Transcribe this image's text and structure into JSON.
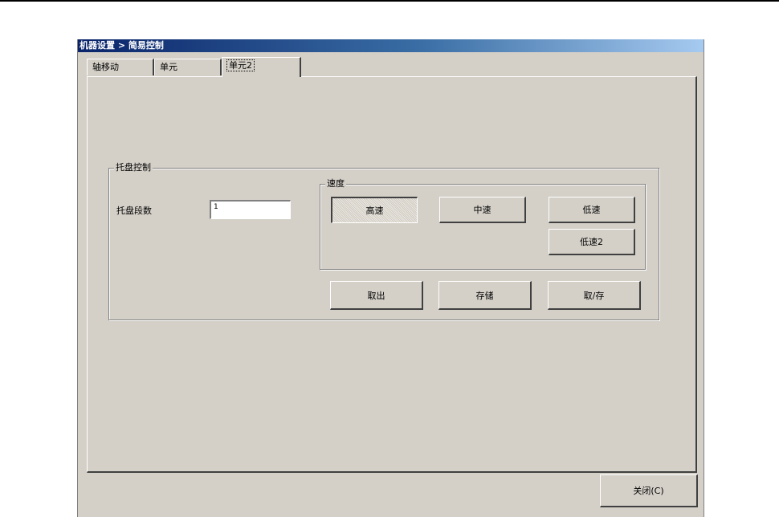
{
  "window": {
    "title": "机器设置 > 简易控制"
  },
  "tabs": [
    {
      "label": "轴移动"
    },
    {
      "label": "单元"
    },
    {
      "label": "单元2"
    }
  ],
  "tray_group": {
    "title": "托盘控制",
    "count_label": "托盘段数",
    "count_value": "1"
  },
  "speed_group": {
    "title": "速度",
    "high": "高速",
    "mid": "中速",
    "low": "低速",
    "low2": "低速2"
  },
  "actions": {
    "take_out": "取出",
    "store": "存储",
    "take_store": "取/存"
  },
  "footer": {
    "close_label": "关闭(C)"
  },
  "state": {
    "active_tab": "单元2",
    "selected_speed": "高速"
  }
}
